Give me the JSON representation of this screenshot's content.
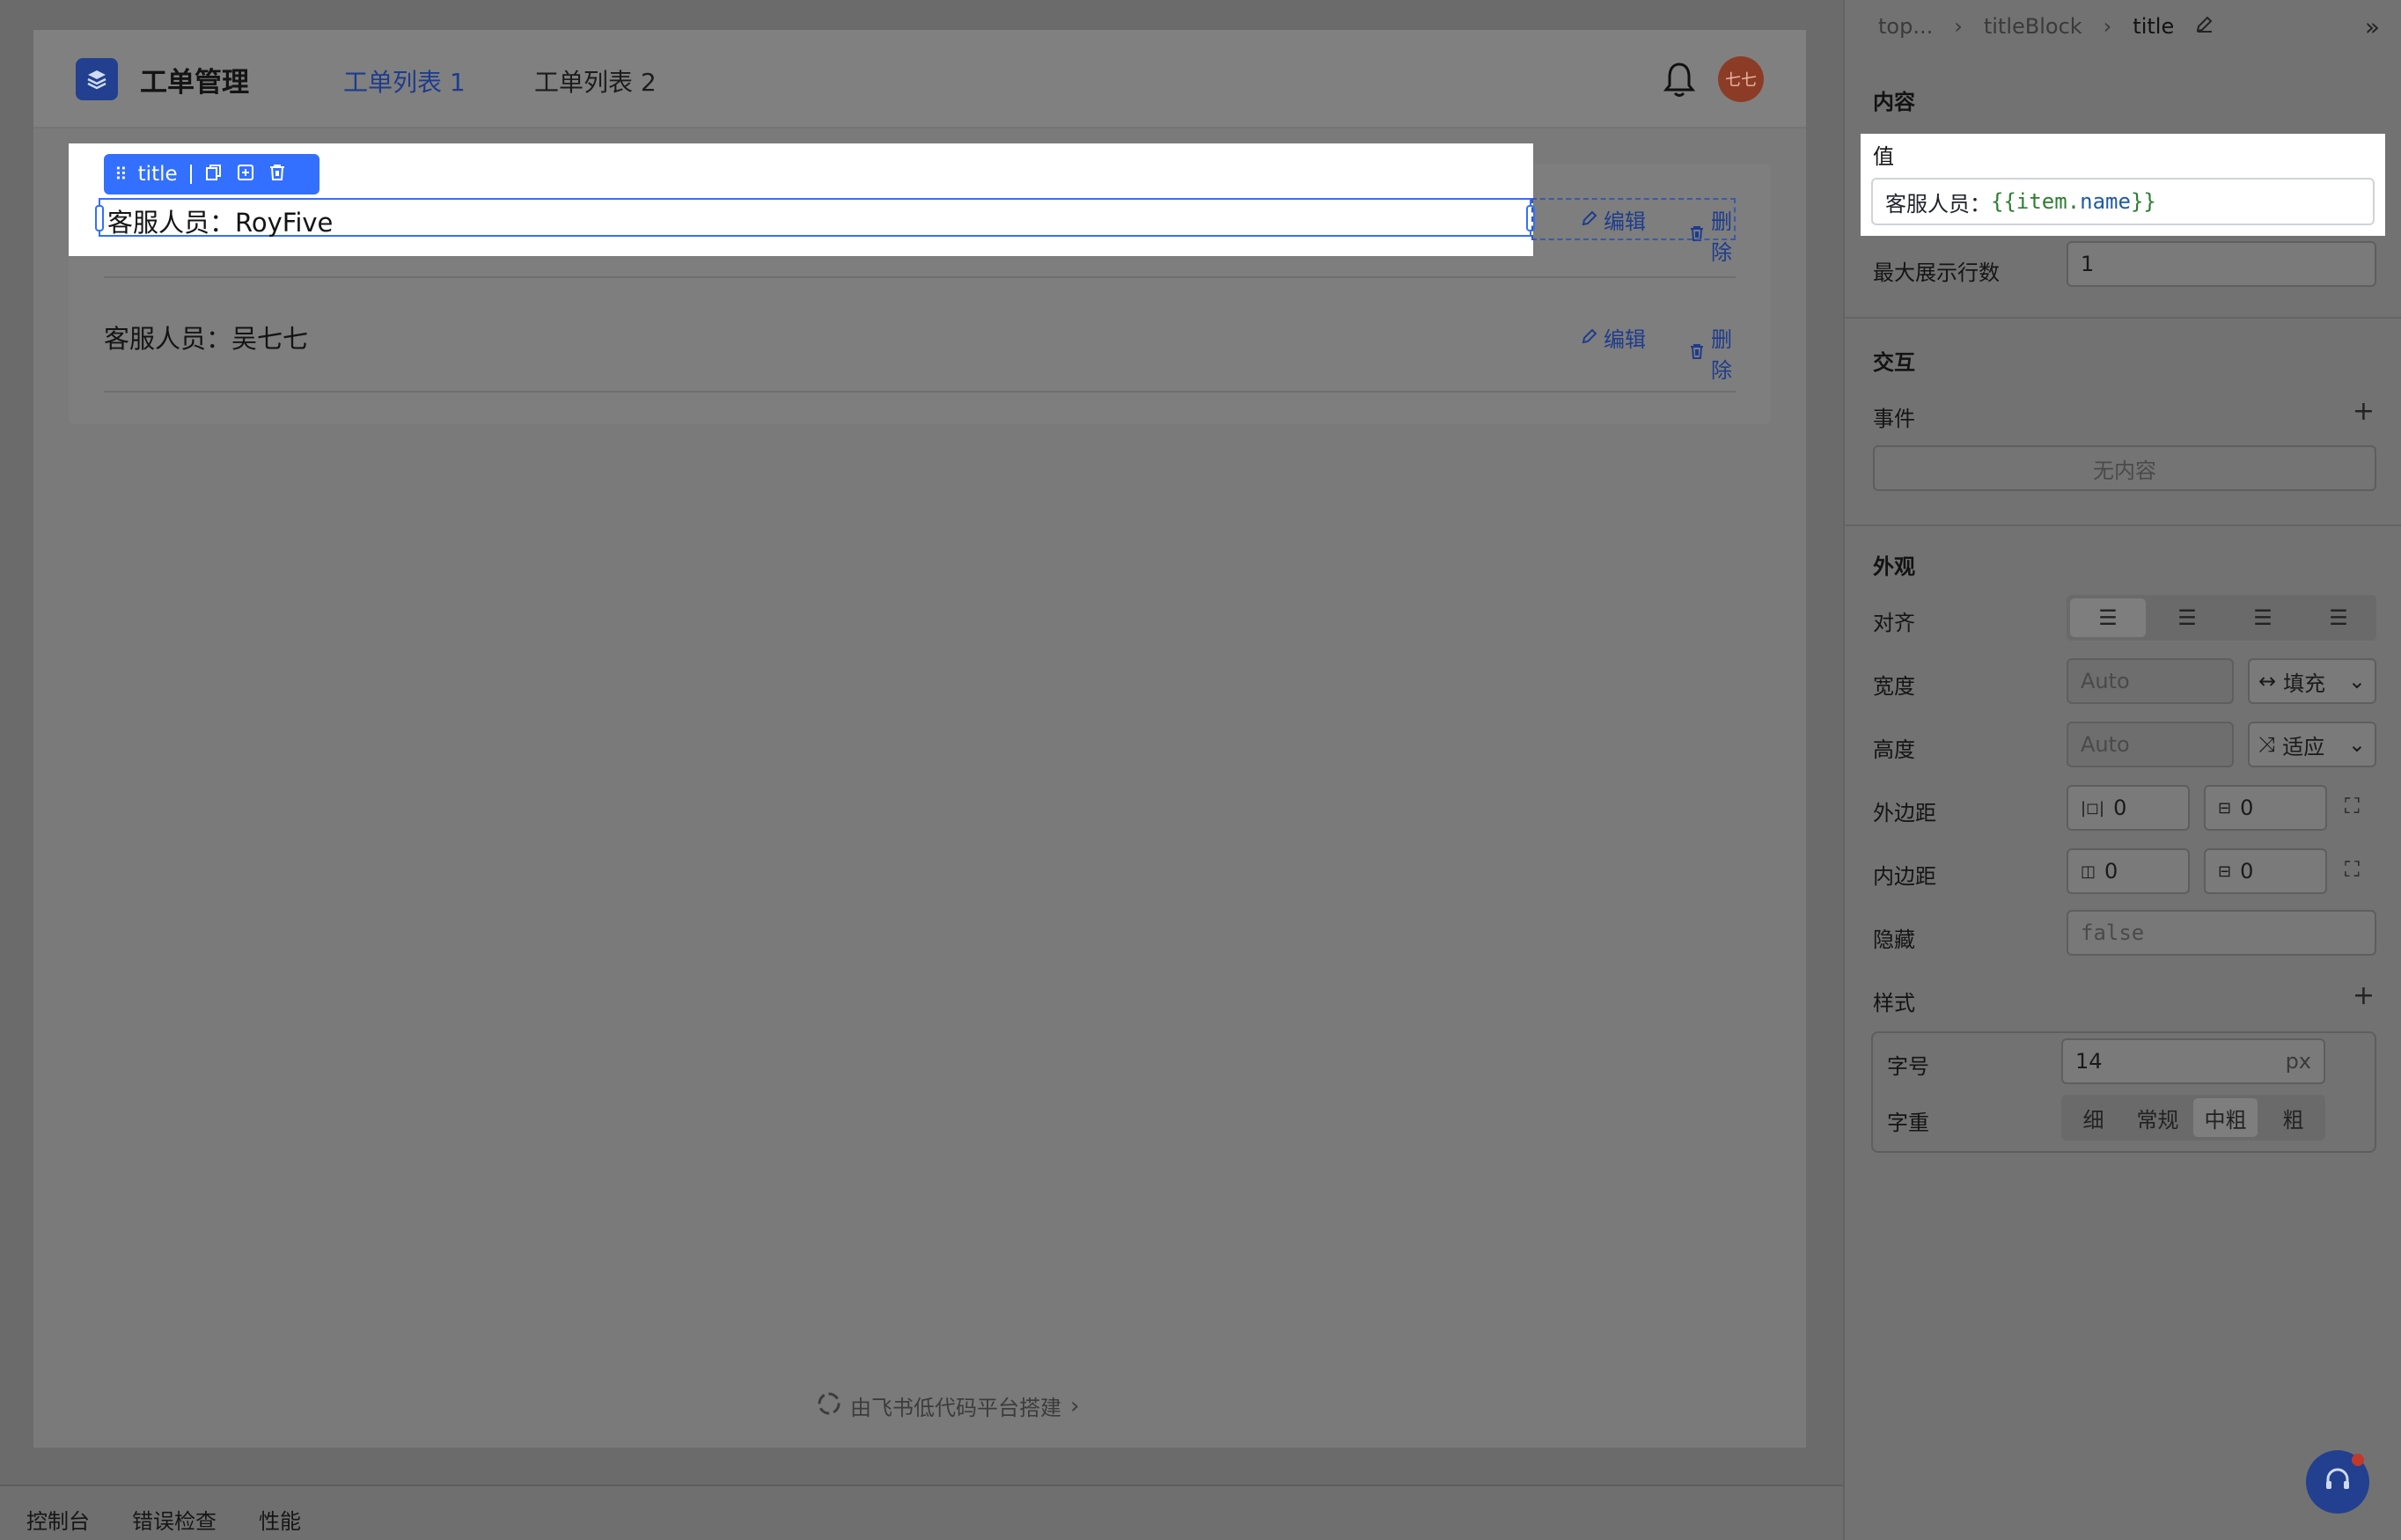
{
  "app": {
    "title": "工单管理",
    "tabs": [
      {
        "label": "工单列表 1",
        "active": true
      },
      {
        "label": "工单列表 2",
        "active": false
      }
    ],
    "avatar_text": "七七"
  },
  "list": {
    "rows": [
      {
        "title": "客服人员：RoyFive",
        "edit": "编辑",
        "delete": "删除"
      },
      {
        "title": "客服人员：吴七七",
        "edit": "编辑",
        "delete": "删除"
      }
    ]
  },
  "selection": {
    "toolbar_label": "title"
  },
  "footer": {
    "brand": "由飞书低代码平台搭建"
  },
  "console": {
    "tabs": [
      "控制台",
      "错误检查",
      "性能"
    ]
  },
  "props": {
    "breadcrumb": [
      "top...",
      "titleBlock",
      "title"
    ],
    "content": {
      "title": "内容",
      "value_label": "值",
      "value_prefix": "客服人员：",
      "value_expr_open": "{{item.",
      "value_expr_var": "name",
      "value_expr_close": "}}",
      "max_lines_label": "最大展示行数",
      "max_lines_value": "1"
    },
    "interaction": {
      "title": "交互",
      "events_label": "事件",
      "empty": "无内容"
    },
    "appearance": {
      "title": "外观",
      "align_label": "对齐",
      "width_label": "宽度",
      "width_value": "Auto",
      "width_mode": "填充",
      "height_label": "高度",
      "height_value": "Auto",
      "height_mode": "适应",
      "margin_label": "外边距",
      "margin_h": "0",
      "margin_v": "0",
      "padding_label": "内边距",
      "padding_h": "0",
      "padding_v": "0",
      "hidden_label": "隐藏",
      "hidden_value": "false"
    },
    "style": {
      "title": "样式",
      "font_size_label": "字号",
      "font_size_value": "14",
      "font_size_unit": "px",
      "font_weight_label": "字重",
      "font_weight_options": [
        "细",
        "常规",
        "中粗",
        "粗"
      ],
      "font_weight_selected": "中粗"
    }
  },
  "colors": {
    "accent": "#3370ff",
    "brand": "#22408f"
  }
}
